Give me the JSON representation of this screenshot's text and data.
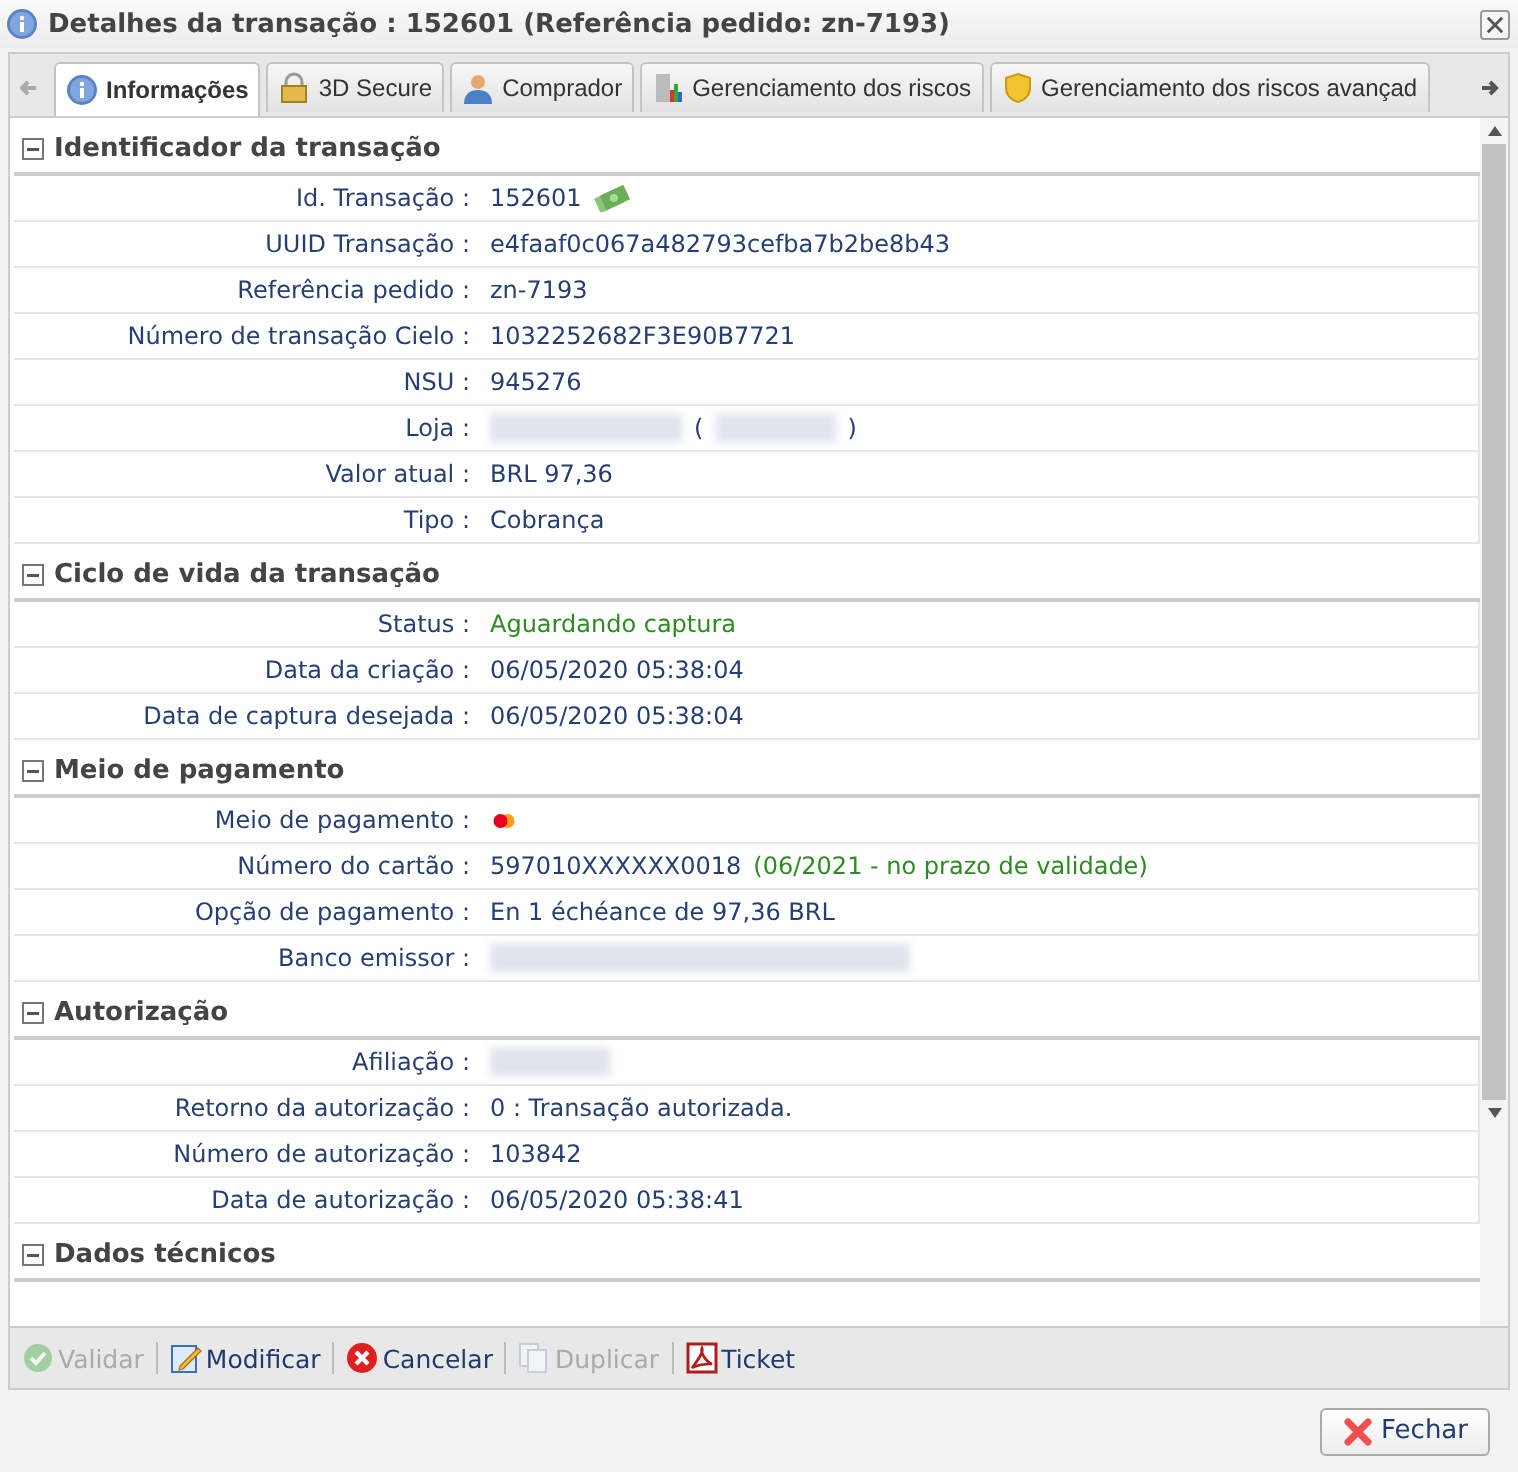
{
  "window": {
    "title": "Detalhes da transação : 152601 (Referência pedido: zn-7193)"
  },
  "tabs": [
    {
      "label": "Informações",
      "selected": true
    },
    {
      "label": "3D Secure",
      "selected": false
    },
    {
      "label": "Comprador",
      "selected": false
    },
    {
      "label": "Gerenciamento dos riscos",
      "selected": false
    },
    {
      "label": "Gerenciamento dos riscos avançad",
      "selected": false
    }
  ],
  "sections": [
    {
      "title": "Identificador da transação",
      "expanded": true,
      "rows": [
        {
          "label": "Id. Transação :",
          "parts": [
            {
              "kind": "text",
              "text": "152601"
            },
            {
              "kind": "money_icon"
            }
          ]
        },
        {
          "label": "UUID Transação :",
          "parts": [
            {
              "kind": "text",
              "text": "e4faaf0c067a482793cefba7b2be8b43"
            }
          ]
        },
        {
          "label": "Referência pedido :",
          "parts": [
            {
              "kind": "text",
              "text": "zn-7193"
            }
          ]
        },
        {
          "label": "Número de transação Cielo :",
          "parts": [
            {
              "kind": "text",
              "text": "1032252682F3E90B7721"
            }
          ]
        },
        {
          "label": "NSU :",
          "parts": [
            {
              "kind": "text",
              "text": "945276"
            }
          ]
        },
        {
          "label": "Loja :",
          "parts": [
            {
              "kind": "redacted_long"
            },
            {
              "kind": "text",
              "text": "("
            },
            {
              "kind": "redacted_short"
            },
            {
              "kind": "text",
              "text": ")"
            }
          ]
        },
        {
          "label": "Valor atual :",
          "parts": [
            {
              "kind": "text",
              "text": "BRL 97,36"
            }
          ]
        },
        {
          "label": "Tipo :",
          "parts": [
            {
              "kind": "text",
              "text": "Cobrança"
            }
          ]
        }
      ]
    },
    {
      "title": "Ciclo de vida da transação",
      "expanded": true,
      "rows": [
        {
          "label": "Status :",
          "parts": [
            {
              "kind": "status",
              "text": "Aguardando captura"
            }
          ]
        },
        {
          "label": "Data da criação :",
          "parts": [
            {
              "kind": "text",
              "text": "06/05/2020 05:38:04"
            }
          ]
        },
        {
          "label": "Data de captura desejada :",
          "parts": [
            {
              "kind": "text",
              "text": "06/05/2020 05:38:04"
            }
          ]
        }
      ]
    },
    {
      "title": "Meio de pagamento",
      "expanded": true,
      "rows": [
        {
          "label": "Meio de pagamento :",
          "parts": [
            {
              "kind": "card_icon"
            }
          ]
        },
        {
          "label": "Número do cartão :",
          "parts": [
            {
              "kind": "text",
              "text": "597010XXXXXX0018"
            },
            {
              "kind": "status",
              "text": "(06/2021 - no prazo de validade)"
            }
          ]
        },
        {
          "label": "Opção de pagamento :",
          "parts": [
            {
              "kind": "text",
              "text": "En 1 échéance de 97,36 BRL"
            }
          ]
        },
        {
          "label": "Banco emissor :",
          "parts": [
            {
              "kind": "redacted_xlong"
            }
          ]
        }
      ]
    },
    {
      "title": "Autorização",
      "expanded": true,
      "rows": [
        {
          "label": "Afiliação :",
          "parts": [
            {
              "kind": "redacted_short"
            }
          ]
        },
        {
          "label": "Retorno da autorização :",
          "parts": [
            {
              "kind": "text",
              "text": "0 : Transação autorizada."
            }
          ]
        },
        {
          "label": "Número de autorização :",
          "parts": [
            {
              "kind": "text",
              "text": "103842"
            }
          ]
        },
        {
          "label": "Data de autorização :",
          "parts": [
            {
              "kind": "text",
              "text": "06/05/2020 05:38:41"
            }
          ]
        }
      ]
    },
    {
      "title": "Dados técnicos",
      "expanded": true
    }
  ],
  "toolbar": [
    {
      "label": "Validar",
      "disabled": true
    },
    {
      "label": "Modificar",
      "disabled": false
    },
    {
      "label": "Cancelar",
      "disabled": false
    },
    {
      "label": "Duplicar",
      "disabled": true
    },
    {
      "label": "Ticket",
      "disabled": false
    }
  ],
  "close_button": {
    "label": "Fechar"
  }
}
